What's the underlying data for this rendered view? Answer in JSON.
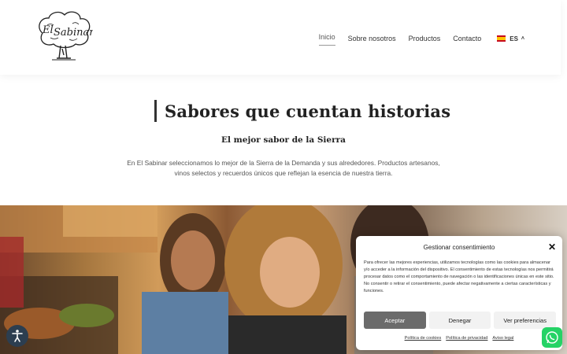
{
  "header": {
    "logo_text": "El Sabinar",
    "nav": [
      {
        "label": "Inicio",
        "active": true
      },
      {
        "label": "Sobre nosotros",
        "active": false
      },
      {
        "label": "Productos",
        "active": false
      },
      {
        "label": "Contacto",
        "active": false
      }
    ],
    "language": {
      "code": "ES",
      "flag_icon": "spain-flag-icon"
    }
  },
  "hero": {
    "title": "Sabores que cuentan historias",
    "subtitle": "El mejor sabor de la Sierra",
    "description": "En El Sabinar seleccionamos lo mejor de la Sierra de la Demanda y sus alrededores. Productos artesanos, vinos selectos y recuerdos únicos que reflejan la esencia de nuestra tierra."
  },
  "photo": {
    "icon": "friends-food-market-photo"
  },
  "accessibility": {
    "icon": "accessibility-icon"
  },
  "consent": {
    "title": "Gestionar consentimiento",
    "text": "Para ofrecer las mejores experiencias, utilizamos tecnologías como las cookies para almacenar y/o acceder a la información del dispositivo. El consentimiento de estas tecnologías nos permitirá procesar datos como el comportamiento de navegación o las identificaciones únicas en este sitio. No consentir o retirar el consentimiento, puede afectar negativamente a ciertas características y funciones.",
    "accept": "Aceptar",
    "deny": "Denegar",
    "preferences": "Ver preferencias",
    "links": [
      "Política de cookies",
      "Política de privacidad",
      "Aviso legal"
    ]
  },
  "whatsapp": {
    "icon": "whatsapp-icon"
  },
  "colors": {
    "accept_bg": "#6b6b6b",
    "whatsapp": "#25d366",
    "access_bg": "#2c3e50"
  }
}
